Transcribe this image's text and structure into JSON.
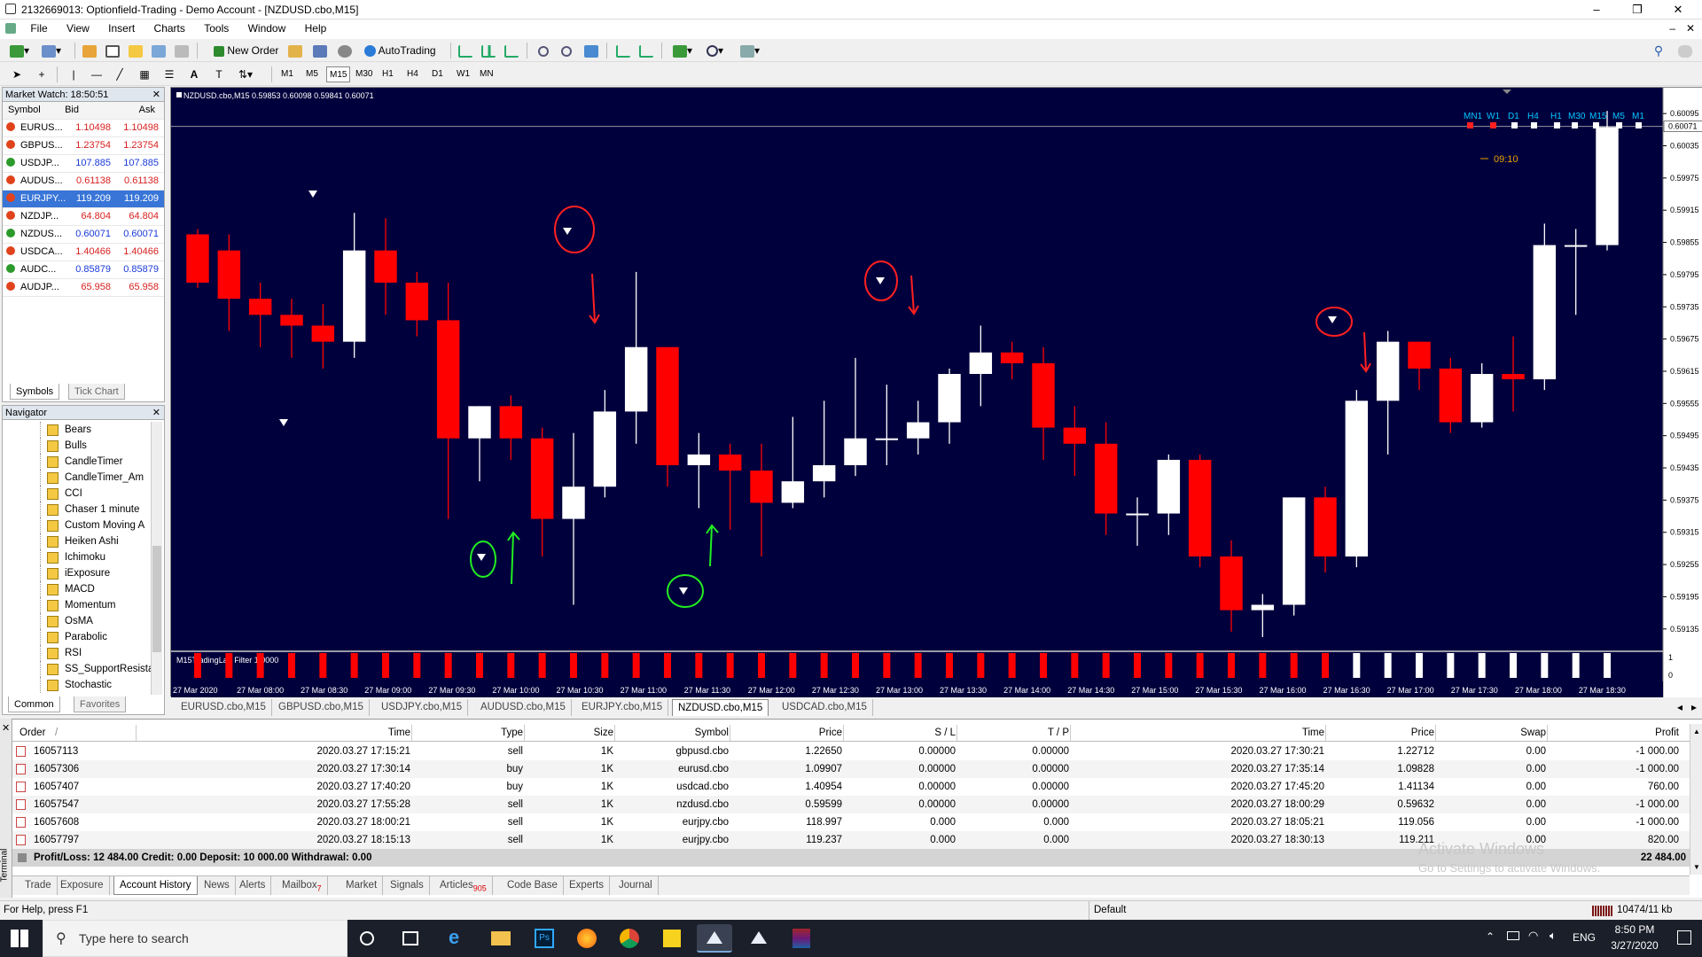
{
  "window": {
    "title": "2132669013: Optionfield-Trading - Demo Account - [NZDUSD.cbo,M15]",
    "minimize": "–",
    "restore": "❐",
    "close": "✕"
  },
  "menu": [
    "File",
    "View",
    "Insert",
    "Charts",
    "Tools",
    "Window",
    "Help"
  ],
  "toolbar": {
    "new_order": "New Order",
    "autotrading": "AutoTrading",
    "timeframes": [
      "M1",
      "M5",
      "M15",
      "M30",
      "H1",
      "H4",
      "D1",
      "W1",
      "MN"
    ],
    "active_timeframe": "M15"
  },
  "market_watch": {
    "title": "Market Watch: 18:50:51",
    "headers": {
      "symbol": "Symbol",
      "bid": "Bid",
      "ask": "Ask"
    },
    "rows": [
      {
        "symbol": "EURUS...",
        "bid": "1.10498",
        "ask": "1.10498",
        "dir": "down"
      },
      {
        "symbol": "GBPUS...",
        "bid": "1.23754",
        "ask": "1.23754",
        "dir": "down"
      },
      {
        "symbol": "USDJP...",
        "bid": "107.885",
        "ask": "107.885",
        "dir": "up"
      },
      {
        "symbol": "AUDUS...",
        "bid": "0.61138",
        "ask": "0.61138",
        "dir": "down"
      },
      {
        "symbol": "EURJPY...",
        "bid": "119.209",
        "ask": "119.209",
        "dir": "down",
        "selected": true
      },
      {
        "symbol": "NZDJP...",
        "bid": "64.804",
        "ask": "64.804",
        "dir": "down"
      },
      {
        "symbol": "NZDUS...",
        "bid": "0.60071",
        "ask": "0.60071",
        "dir": "up"
      },
      {
        "symbol": "USDCA...",
        "bid": "1.40466",
        "ask": "1.40466",
        "dir": "down"
      },
      {
        "symbol": "AUDC...",
        "bid": "0.85879",
        "ask": "0.85879",
        "dir": "up"
      },
      {
        "symbol": "AUDJP...",
        "bid": "65.958",
        "ask": "65.958",
        "dir": "down"
      }
    ],
    "tabs": [
      "Symbols",
      "Tick Chart"
    ]
  },
  "navigator": {
    "title": "Navigator",
    "items": [
      "Bears",
      "Bulls",
      "CandleTimer",
      "CandleTimer_Am",
      "CCI",
      "Chaser 1 minute",
      "Custom Moving A",
      "Heiken Ashi",
      "Ichimoku",
      "iExposure",
      "MACD",
      "Momentum",
      "OsMA",
      "Parabolic",
      "RSI",
      "SS_SupportResista",
      "Stochastic"
    ],
    "tabs": [
      "Common",
      "Favorites"
    ]
  },
  "chart": {
    "header": "NZDUSD.cbo,M15  0.59853 0.60098 0.59841 0.60071",
    "timer": "09:10",
    "tf_labels": [
      "MN1",
      "W1",
      "D1",
      "H4",
      "H1",
      "M30",
      "M15",
      "M5",
      "M1"
    ],
    "indicator_label": "M15TradingLab Filter 1.0000",
    "indicator_scale": [
      "1",
      "0"
    ],
    "colors": {
      "bg": "#00003c",
      "bull": "#ffffff",
      "bear": "#ff0000",
      "grid": "#ffffff"
    }
  },
  "chart_data": {
    "type": "candlestick",
    "title": "NZDUSD.cbo,M15",
    "ylim": [
      0.591,
      0.6012
    ],
    "yticks": [
      "0.60095",
      "0.60035",
      "0.59975",
      "0.59915",
      "0.59855",
      "0.59795",
      "0.59735",
      "0.59675",
      "0.59615",
      "0.59555",
      "0.59495",
      "0.59435",
      "0.59375",
      "0.59315",
      "0.59255",
      "0.59195",
      "0.59135"
    ],
    "yticks_values": [
      0.60095,
      0.60035,
      0.59975,
      0.59915,
      0.59855,
      0.59795,
      0.59735,
      0.59675,
      0.59615,
      0.59555,
      0.59495,
      0.59435,
      0.59375,
      0.59315,
      0.59255,
      0.59195,
      0.59135
    ],
    "current_price": "0.60071",
    "current_value": 0.60071,
    "xlabels": [
      "27 Mar 2020",
      "27 Mar 08:00",
      "27 Mar 08:30",
      "27 Mar 09:00",
      "27 Mar 09:30",
      "27 Mar 10:00",
      "27 Mar 10:30",
      "27 Mar 11:00",
      "27 Mar 11:30",
      "27 Mar 12:00",
      "27 Mar 12:30",
      "27 Mar 13:00",
      "27 Mar 13:30",
      "27 Mar 14:00",
      "27 Mar 14:30",
      "27 Mar 15:00",
      "27 Mar 15:30",
      "27 Mar 16:00",
      "27 Mar 16:30",
      "27 Mar 17:00",
      "27 Mar 17:30",
      "27 Mar 18:00",
      "27 Mar 18:30"
    ],
    "candles": [
      [
        0.5987,
        0.5988,
        0.5977,
        0.5978
      ],
      [
        0.5984,
        0.5987,
        0.5969,
        0.5975
      ],
      [
        0.5975,
        0.5978,
        0.5966,
        0.5972
      ],
      [
        0.5972,
        0.5975,
        0.5964,
        0.597
      ],
      [
        0.597,
        0.5974,
        0.5962,
        0.5967
      ],
      [
        0.5967,
        0.5991,
        0.5964,
        0.5984
      ],
      [
        0.5984,
        0.599,
        0.5972,
        0.5978
      ],
      [
        0.5978,
        0.598,
        0.5968,
        0.5971
      ],
      [
        0.5971,
        0.5978,
        0.5934,
        0.5949
      ],
      [
        0.5949,
        0.5955,
        0.5941,
        0.5955
      ],
      [
        0.5955,
        0.5957,
        0.5945,
        0.5949
      ],
      [
        0.5949,
        0.5951,
        0.5927,
        0.5934
      ],
      [
        0.5934,
        0.595,
        0.5918,
        0.594
      ],
      [
        0.594,
        0.5958,
        0.5938,
        0.5954
      ],
      [
        0.5954,
        0.598,
        0.5948,
        0.5966
      ],
      [
        0.5966,
        0.5966,
        0.594,
        0.5944
      ],
      [
        0.5944,
        0.595,
        0.5936,
        0.5946
      ],
      [
        0.5946,
        0.5948,
        0.5932,
        0.5943
      ],
      [
        0.5943,
        0.5948,
        0.5927,
        0.5937
      ],
      [
        0.5937,
        0.5953,
        0.5936,
        0.5941
      ],
      [
        0.5941,
        0.5956,
        0.5938,
        0.5944
      ],
      [
        0.5944,
        0.5964,
        0.5942,
        0.5949
      ],
      [
        0.5949,
        0.5959,
        0.5944,
        0.5949
      ],
      [
        0.5949,
        0.5956,
        0.5946,
        0.5952
      ],
      [
        0.5952,
        0.5962,
        0.5948,
        0.5961
      ],
      [
        0.5961,
        0.597,
        0.5955,
        0.5965
      ],
      [
        0.5965,
        0.5967,
        0.596,
        0.5963
      ],
      [
        0.5963,
        0.5966,
        0.5945,
        0.5951
      ],
      [
        0.5951,
        0.5955,
        0.5942,
        0.5948
      ],
      [
        0.5948,
        0.5952,
        0.5931,
        0.5935
      ],
      [
        0.5935,
        0.5938,
        0.5929,
        0.5935
      ],
      [
        0.5935,
        0.5946,
        0.5931,
        0.5945
      ],
      [
        0.5945,
        0.5946,
        0.5925,
        0.5927
      ],
      [
        0.5927,
        0.593,
        0.5913,
        0.5917
      ],
      [
        0.5917,
        0.592,
        0.5912,
        0.5918
      ],
      [
        0.5918,
        0.5938,
        0.5916,
        0.5938
      ],
      [
        0.5938,
        0.594,
        0.5924,
        0.5927
      ],
      [
        0.5927,
        0.5958,
        0.5925,
        0.5956
      ],
      [
        0.5956,
        0.5969,
        0.5946,
        0.5967
      ],
      [
        0.5967,
        0.5967,
        0.5958,
        0.5962
      ],
      [
        0.5962,
        0.5964,
        0.595,
        0.5952
      ],
      [
        0.5952,
        0.5963,
        0.5951,
        0.5961
      ],
      [
        0.5961,
        0.5968,
        0.5954,
        0.596
      ],
      [
        0.596,
        0.5989,
        0.5958,
        0.5985
      ],
      [
        0.5985,
        0.5988,
        0.5972,
        0.5985
      ],
      [
        0.5985,
        0.601,
        0.5984,
        0.6007
      ]
    ],
    "filter_bars_red": 37,
    "filter_bars_white": 9
  },
  "chart_tabs": [
    "EURUSD.cbo,M15",
    "GBPUSD.cbo,M15",
    "USDJPY.cbo,M15",
    "AUDUSD.cbo,M15",
    "EURJPY.cbo,M15",
    "NZDUSD.cbo,M15",
    "USDCAD.cbo,M15"
  ],
  "active_chart_tab": "NZDUSD.cbo,M15",
  "terminal": {
    "headers": [
      "Order",
      "Time",
      "Type",
      "Size",
      "Symbol",
      "Price",
      "S / L",
      "T / P",
      "Time",
      "Price",
      "Swap",
      "Profit"
    ],
    "sort_mark": "/",
    "rows": [
      [
        "16057113",
        "2020.03.27 17:15:21",
        "sell",
        "1K",
        "gbpusd.cbo",
        "1.22650",
        "0.00000",
        "0.00000",
        "2020.03.27 17:30:21",
        "1.22712",
        "0.00",
        "-1 000.00"
      ],
      [
        "16057306",
        "2020.03.27 17:30:14",
        "buy",
        "1K",
        "eurusd.cbo",
        "1.09907",
        "0.00000",
        "0.00000",
        "2020.03.27 17:35:14",
        "1.09828",
        "0.00",
        "-1 000.00"
      ],
      [
        "16057407",
        "2020.03.27 17:40:20",
        "buy",
        "1K",
        "usdcad.cbo",
        "1.40954",
        "0.00000",
        "0.00000",
        "2020.03.27 17:45:20",
        "1.41134",
        "0.00",
        "760.00"
      ],
      [
        "16057547",
        "2020.03.27 17:55:28",
        "sell",
        "1K",
        "nzdusd.cbo",
        "0.59599",
        "0.00000",
        "0.00000",
        "2020.03.27 18:00:29",
        "0.59632",
        "0.00",
        "-1 000.00"
      ],
      [
        "16057608",
        "2020.03.27 18:00:21",
        "sell",
        "1K",
        "eurjpy.cbo",
        "118.997",
        "0.000",
        "0.000",
        "2020.03.27 18:05:21",
        "119.056",
        "0.00",
        "-1 000.00"
      ],
      [
        "16057797",
        "2020.03.27 18:15:13",
        "sell",
        "1K",
        "eurjpy.cbo",
        "119.237",
        "0.000",
        "0.000",
        "2020.03.27 18:30:13",
        "119.211",
        "0.00",
        "820.00"
      ]
    ],
    "summary": "Profit/Loss: 12 484.00  Credit: 0.00  Deposit: 10 000.00  Withdrawal: 0.00",
    "summary_total": "22 484.00",
    "side_label": "Terminal",
    "tabs": [
      {
        "label": "Trade"
      },
      {
        "label": "Exposure"
      },
      {
        "label": "Account History",
        "active": true
      },
      {
        "label": "News"
      },
      {
        "label": "Alerts"
      },
      {
        "label": "Mailbox",
        "badge": "7"
      },
      {
        "label": "Market"
      },
      {
        "label": "Signals"
      },
      {
        "label": "Articles",
        "badge": "905"
      },
      {
        "label": "Code Base"
      },
      {
        "label": "Experts"
      },
      {
        "label": "Journal"
      }
    ],
    "watermark_line1": "Activate Windows",
    "watermark_line2": "Go to Settings to activate Windows."
  },
  "status": {
    "help": "For Help, press F1",
    "profile": "Default",
    "traffic": "10474/11 kb"
  },
  "taskbar": {
    "search_placeholder": "Type here to search",
    "time": "8:50 PM",
    "date": "3/27/2020",
    "lang": "ENG"
  }
}
